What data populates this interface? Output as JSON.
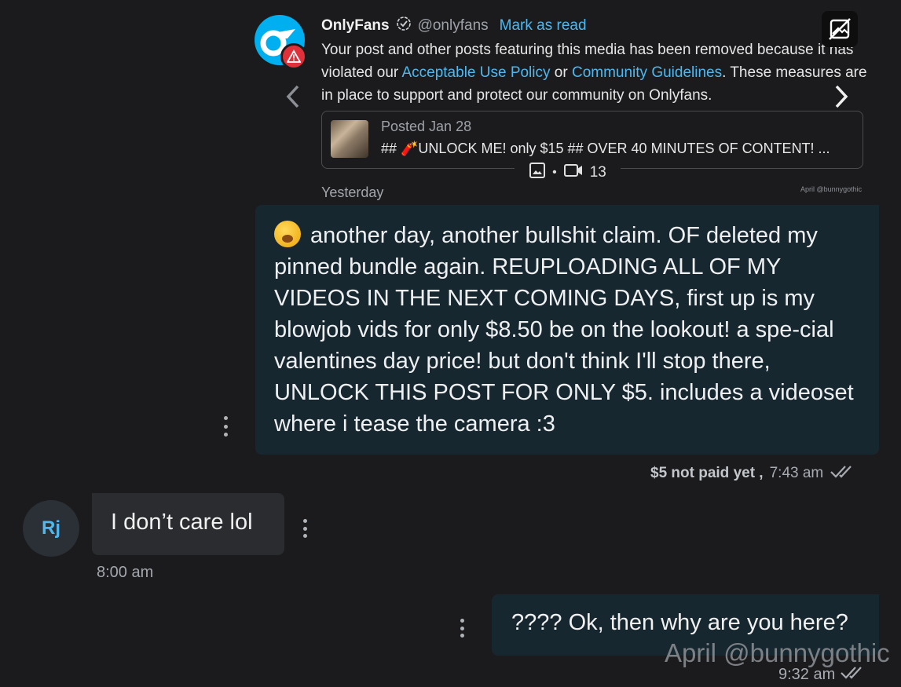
{
  "notification": {
    "sender": "OnlyFans",
    "handle": "@onlyfans",
    "mark_read": "Mark as read",
    "body_pre": "Your post and other posts featuring this media has been removed because it has violated our ",
    "link1": "Acceptable Use Policy",
    "mid": " or ",
    "link2": "Community Guidelines",
    "body_post": ". These measures are in place to support and protect our community on Onlyfans.",
    "post_date": "Posted Jan 28",
    "post_title": "## 🧨UNLOCK ME! only $15 ## OVER 40 MINUTES OF CONTENT! ...",
    "video_count": "13",
    "icons": [
      "onlyfans-logo-icon",
      "warning-icon",
      "verified-icon",
      "chevron-left-icon",
      "chevron-right-icon",
      "image-icon",
      "video-icon",
      "image-off-icon"
    ]
  },
  "day_label": "Yesterday",
  "watermark_small": "April @bunnygothic",
  "messages": {
    "out1": {
      "text": "another day, another bullshit claim. OF deleted my pinned bundle again. REUPLOADING ALL OF MY VIDEOS IN THE NEXT COMING DAYS, first up is my blowjob vids for only $8.50 be on the lookout! a spe-cial valentines day price! but don't think I'll stop there, UNLOCK THIS POST FOR ONLY $5. includes a videoset where i tease the camera :3",
      "paid_status": "$5 not paid yet ,",
      "time": "7:43 am"
    },
    "in1": {
      "avatar_initials": "Rj",
      "text": "I don’t care lol",
      "time": "8:00 am"
    },
    "out2": {
      "text": "???? Ok, then why are you here?",
      "time": "9:32 am"
    }
  },
  "watermark": "April @bunnygothic",
  "colors": {
    "background": "#1b1b1d",
    "outgoing_bubble": "#17272f",
    "incoming_bubble": "#2a2c30",
    "link": "#4fb8f0",
    "warning": "#e0313b"
  }
}
